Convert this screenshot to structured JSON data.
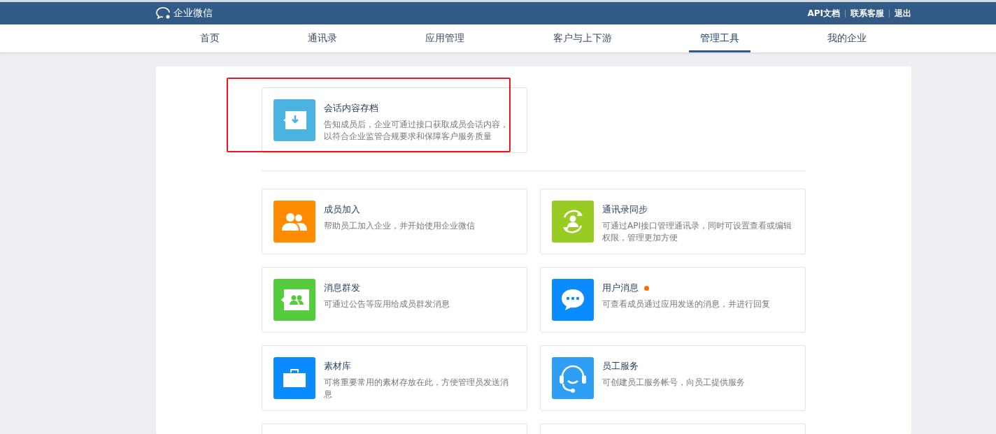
{
  "header": {
    "logo": "企业微信",
    "links": [
      "API文档",
      "联系客服",
      "退出"
    ]
  },
  "tabs": [
    {
      "label": "首页",
      "selected": false
    },
    {
      "label": "通讯录",
      "selected": false
    },
    {
      "label": "应用管理",
      "selected": false
    },
    {
      "label": "客户与上下游",
      "selected": false
    },
    {
      "label": "管理工具",
      "selected": true
    },
    {
      "label": "我的企业",
      "selected": false
    }
  ],
  "featured": {
    "title": "会话内容存档",
    "description": "告知成员后，企业可通过接口获取成员会话内容，以符合企业监管合规要求和保障客户服务质量",
    "color": "#4ab3e0",
    "highlighted": true
  },
  "tools": [
    {
      "title": "成员加入",
      "description": "帮助员工加入企业，并开始使用企业微信",
      "color": "#ff8c00",
      "dot": false
    },
    {
      "title": "通讯录同步",
      "description": "可通过API接口管理通讯录，同时可设置查看或编辑权限，管理更加方便",
      "color": "#99cc22",
      "dot": false
    },
    {
      "title": "消息群发",
      "description": "可通过公告等应用给成员群发消息",
      "color": "#55cc3e",
      "dot": false
    },
    {
      "title": "用户消息",
      "description": "可查看成员通过应用发送的消息，并进行回复",
      "color": "#0a8cff",
      "dot": true
    },
    {
      "title": "素材库",
      "description": "可将重要常用的素材存放在此，方便管理员发送消息",
      "color": "#0a8cff",
      "dot": false
    },
    {
      "title": "员工服务",
      "description": "可创建员工服务帐号，向员工提供服务",
      "color": "#2e9ff5",
      "dot": false
    }
  ]
}
